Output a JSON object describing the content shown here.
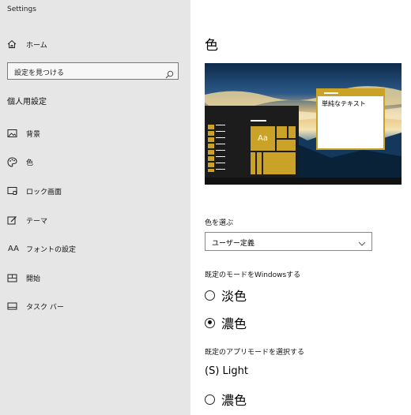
{
  "window": {
    "title": "Settings"
  },
  "sidebar": {
    "home_label": "ホーム",
    "search_placeholder": "設定を見つける",
    "section_title": "個人用設定",
    "items": [
      {
        "label": "背景",
        "icon": "picture-icon"
      },
      {
        "label": "色",
        "icon": "palette-icon"
      },
      {
        "label": "ロック画面",
        "icon": "lock-screen-icon"
      },
      {
        "label": "テーマ",
        "icon": "theme-brush-icon"
      },
      {
        "label": "フォントの設定",
        "icon": "fonts-icon",
        "icon_text": "AA"
      },
      {
        "label": "開始",
        "icon": "start-icon"
      },
      {
        "label": "タスク バー",
        "icon": "taskbar-icon"
      }
    ]
  },
  "main": {
    "title": "色",
    "preview": {
      "tile_text": "Aa",
      "window_text": "単純なテキスト",
      "accent": "#c9a227"
    },
    "choose_color": {
      "label": "色を選ぶ",
      "value": "ユーザー定義"
    },
    "windows_mode": {
      "label": "既定のモードをWindowsする",
      "options": [
        {
          "label": "淡色",
          "selected": false
        },
        {
          "label": "濃色",
          "selected": true
        }
      ]
    },
    "app_mode": {
      "label": "既定のアプリモードを選択する",
      "options": [
        {
          "label": "(S) Light"
        },
        {
          "label": "濃色",
          "selected": false
        }
      ]
    }
  }
}
